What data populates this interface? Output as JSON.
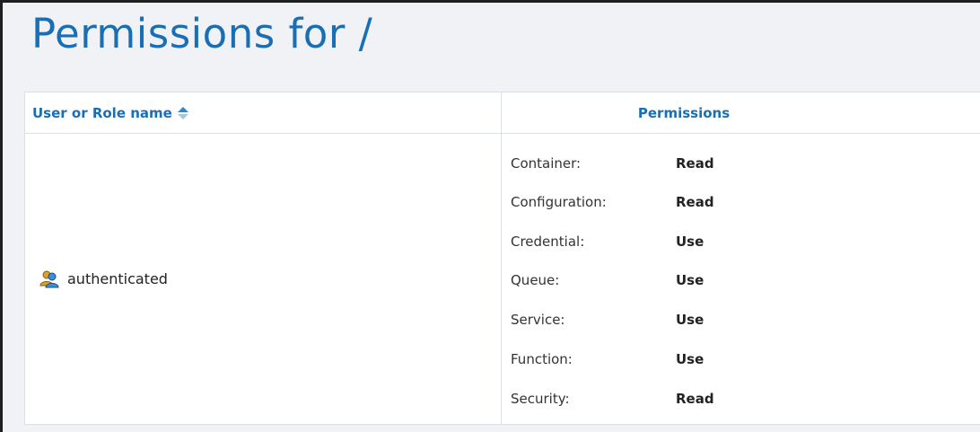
{
  "page": {
    "title": "Permissions for /"
  },
  "table": {
    "columns": {
      "user": "User or Role name",
      "permissions": "Permissions"
    },
    "rows": [
      {
        "name": "authenticated",
        "icon": "user-group-icon",
        "permissions": [
          {
            "label": "Container:",
            "value": "Read"
          },
          {
            "label": "Configuration:",
            "value": "Read"
          },
          {
            "label": "Credential:",
            "value": "Use"
          },
          {
            "label": "Queue:",
            "value": "Use"
          },
          {
            "label": "Service:",
            "value": "Use"
          },
          {
            "label": "Function:",
            "value": "Use"
          },
          {
            "label": "Security:",
            "value": "Read"
          }
        ]
      }
    ]
  },
  "colors": {
    "accent": "#1a6fb4",
    "background": "#f0f2f5"
  }
}
